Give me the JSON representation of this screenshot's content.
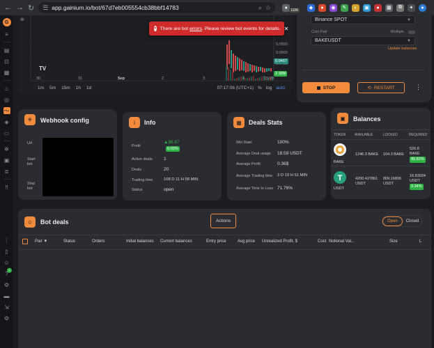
{
  "browser": {
    "url": "app.gainium.io/bot/67d7eb005554cb38bbf14783",
    "ext_badge": "1106"
  },
  "chart": {
    "x_ticks": [
      "30",
      "31",
      "Sep",
      "2",
      "3",
      "4",
      "15:00"
    ],
    "y_ticks": [
      "0.0550",
      "0.0500",
      "0.0450"
    ],
    "price_tag_1": "0.0467",
    "price_tag_2": "2.38M",
    "time_buttons": [
      "1m",
      "5m",
      "15m",
      "1h",
      "1d"
    ],
    "clock": "07:17:06 (UTC+1)",
    "pct": "%",
    "log": "log",
    "auto": "auto",
    "tv_logo": "TV"
  },
  "alert": {
    "prefix": "There are bot ",
    "link": "errors",
    "suffix": ". Please review bot events for details."
  },
  "controls": {
    "exchange": "Binance SPOT",
    "coin_pair_label": "Coin Pair",
    "multiple_label": "Multiple",
    "pair": "BAKEUSDT",
    "update_balances": "Update balances",
    "stop_label": "STOP",
    "restart_label": "RESTART"
  },
  "webhook": {
    "title": "Webhook config",
    "url_label": "Url",
    "start_label": "Start bot",
    "stop_label": "Stop bot"
  },
  "info": {
    "title": "Info",
    "profit_label": "Profit",
    "profit_value": "$6.87",
    "profit_pct": "0.03%",
    "active_deals_label": "Active deals",
    "active_deals_value": "1",
    "deals_label": "Deals",
    "deals_value": "20",
    "trading_time_label": "Trading time",
    "trading_time_value": "168 D 11 H 58 MIN",
    "status_label": "Status",
    "status_value": "open"
  },
  "deals_stats": {
    "title": "Deals Stats",
    "win_rate_label": "Win Rate",
    "win_rate_value": "100%",
    "avg_usage_label": "Average Deal usage",
    "avg_usage_value": "18.59 USDT",
    "avg_profit_label": "Average Profit",
    "avg_profit_value": "0.36$",
    "avg_trading_label": "Average Trading time",
    "avg_trading_value": "3 D 19 H 51 MIN",
    "avg_loss_label": "Average Time In Loss",
    "avg_loss_value": "71.76%"
  },
  "balances": {
    "title": "Balances",
    "headers": [
      "TOKEN",
      "AVAILABLE",
      "LOCKED",
      "REQUIRED"
    ],
    "rows": [
      {
        "token": "BAKE",
        "available": "1246.3 BAKE",
        "locked": "104.3 BAKE",
        "required_1": "526.8",
        "required_2": "BAKE",
        "required_pct": "85.62%"
      },
      {
        "token": "USDT",
        "available_1": "4200.427861",
        "available_2": "USDT",
        "locked_1": "809.16806",
        "locked_2": "USDT",
        "required_1": "16.83024",
        "required_2": "USDT",
        "required_pct": "0.34%"
      }
    ]
  },
  "bot_deals": {
    "title": "Bot deals",
    "actions_label": "Actions",
    "tab_open": "Open",
    "tab_closed": "Closed",
    "columns": [
      "Pair",
      "Status",
      "Orders",
      "Initial balances",
      "Current balances",
      "Entry price",
      "Avg price",
      "Unrealized Profit, $",
      "Cost",
      "Notional Val...",
      "Size",
      "L"
    ]
  },
  "colors": {
    "accent": "#f28b3c",
    "panel": "#2a2c31",
    "background": "#1b1c1f",
    "alert": "#cf2b2b",
    "positive": "#2fb344"
  }
}
